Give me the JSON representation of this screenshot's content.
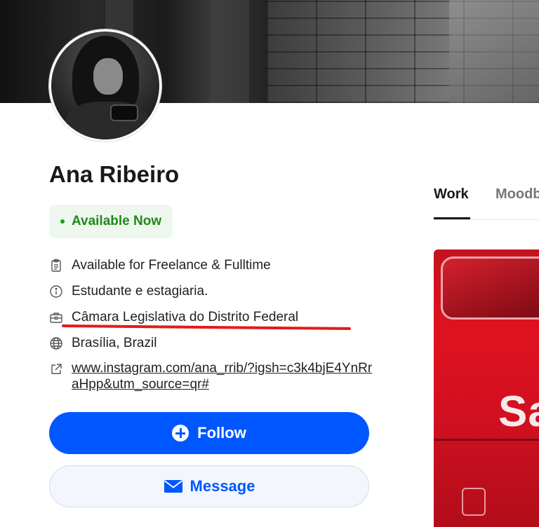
{
  "profile": {
    "name": "Ana Ribeiro",
    "availability_badge": "Available Now",
    "colors": {
      "follow": "#0057ff",
      "available": "#1f8a1b",
      "highlight": "#e21b1b"
    }
  },
  "info": {
    "items": [
      {
        "icon": "clipboard-icon",
        "text": "Available for Freelance & Fulltime"
      },
      {
        "icon": "info-icon",
        "text": "Estudante e estagiaria."
      },
      {
        "icon": "briefcase-icon",
        "text": "Câmara Legislativa do Distrito Federal"
      },
      {
        "icon": "globe-icon",
        "text": "Brasília, Brazil"
      }
    ],
    "link": {
      "icon": "external-link-icon",
      "text": "www.instagram.com/ana_rrib/?igsh=c3k4bjE4YnRraHpp&utm_source=qr#"
    }
  },
  "actions": {
    "follow_label": "Follow",
    "message_label": "Message"
  },
  "tabs": [
    {
      "label": "Work",
      "active": true
    },
    {
      "label": "Moodboards",
      "active": false
    }
  ],
  "project_thumb": {
    "visible_text": "Sa"
  }
}
